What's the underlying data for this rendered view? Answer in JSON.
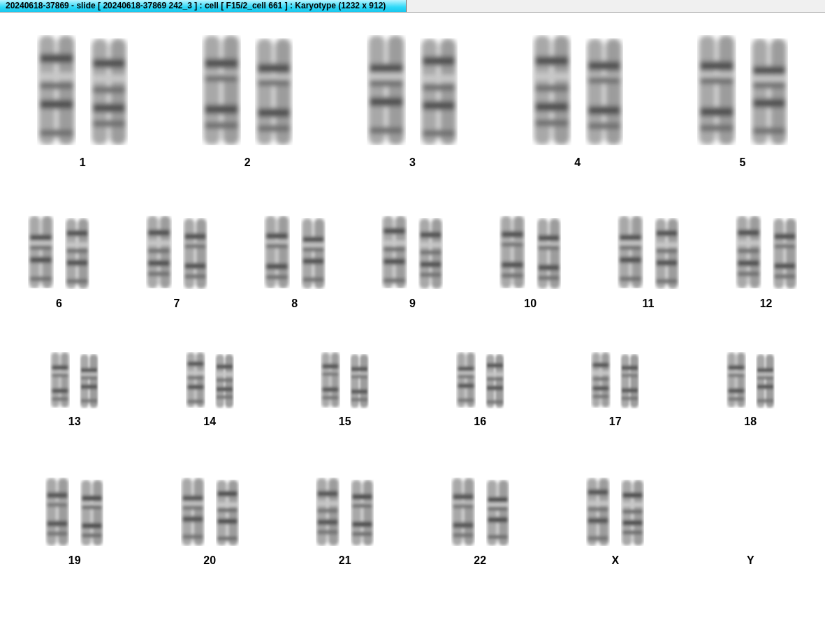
{
  "window": {
    "title": "20240618-37869 - slide [ 20240618-37869 242_3 ] : cell [ F15/2_cell 661 ] : Karyotype  (1232 x 912)"
  },
  "rows": [
    {
      "groups": [
        {
          "label": "1",
          "kind": "pair"
        },
        {
          "label": "2",
          "kind": "pair"
        },
        {
          "label": "3",
          "kind": "pair"
        },
        {
          "label": "4",
          "kind": "pair"
        },
        {
          "label": "5",
          "kind": "pair"
        }
      ]
    },
    {
      "groups": [
        {
          "label": "6",
          "kind": "pair"
        },
        {
          "label": "7",
          "kind": "pair"
        },
        {
          "label": "8",
          "kind": "pair"
        },
        {
          "label": "9",
          "kind": "pair"
        },
        {
          "label": "10",
          "kind": "pair"
        },
        {
          "label": "11",
          "kind": "pair"
        },
        {
          "label": "12",
          "kind": "pair"
        }
      ]
    },
    {
      "groups": [
        {
          "label": "13",
          "kind": "pair"
        },
        {
          "label": "14",
          "kind": "pair"
        },
        {
          "label": "15",
          "kind": "pair"
        },
        {
          "label": "16",
          "kind": "pair"
        },
        {
          "label": "17",
          "kind": "pair"
        },
        {
          "label": "18",
          "kind": "pair"
        }
      ]
    },
    {
      "groups": [
        {
          "label": "19",
          "kind": "pair"
        },
        {
          "label": "20",
          "kind": "pair"
        },
        {
          "label": "21",
          "kind": "pair"
        },
        {
          "label": "22",
          "kind": "pair"
        },
        {
          "label": "X",
          "kind": "pair"
        },
        {
          "label": "Y",
          "kind": "empty"
        }
      ]
    }
  ]
}
